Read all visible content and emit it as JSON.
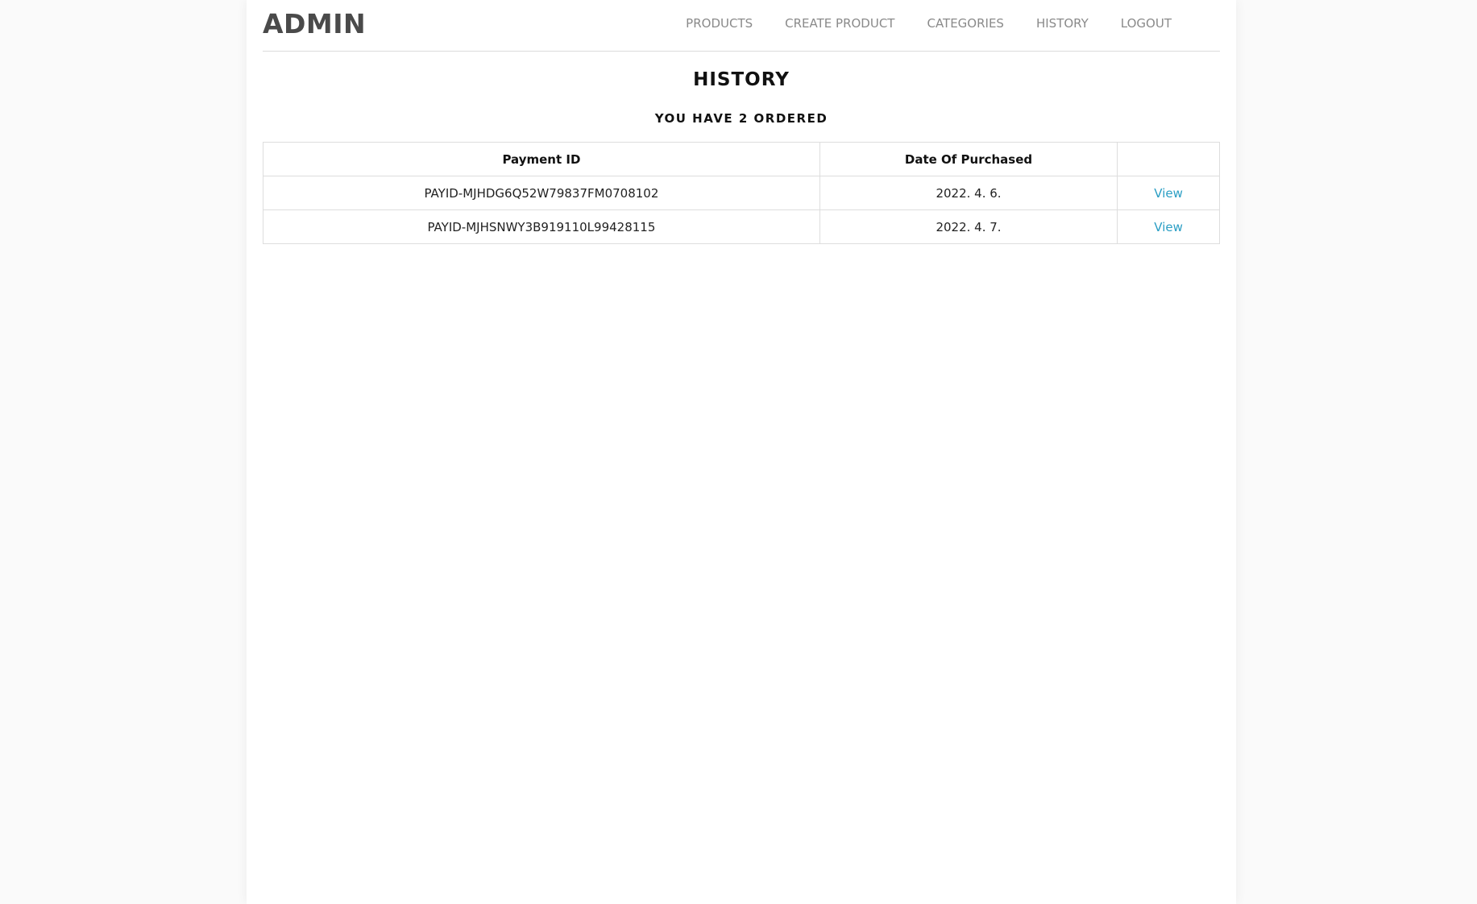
{
  "header": {
    "brand": "ADMIN",
    "nav": [
      {
        "label": "PRODUCTS"
      },
      {
        "label": "CREATE PRODUCT"
      },
      {
        "label": "CATEGORIES"
      },
      {
        "label": "HISTORY"
      },
      {
        "label": "LOGOUT"
      }
    ]
  },
  "main": {
    "title": "HISTORY",
    "order_count": "YOU HAVE 2 ORDERED",
    "table": {
      "columns": [
        "Payment ID",
        "Date Of Purchased",
        ""
      ],
      "rows": [
        {
          "payment_id": "PAYID-MJHDG6Q52W79837FM0708102",
          "date": "2022. 4. 6.",
          "action": "View"
        },
        {
          "payment_id": "PAYID-MJHSNWY3B919110L99428115",
          "date": "2022. 4. 7.",
          "action": "View"
        }
      ]
    }
  },
  "colors": {
    "link": "#2a9ec4",
    "nav_text": "#8a8a8a",
    "brand_text": "#4a4a4a"
  }
}
